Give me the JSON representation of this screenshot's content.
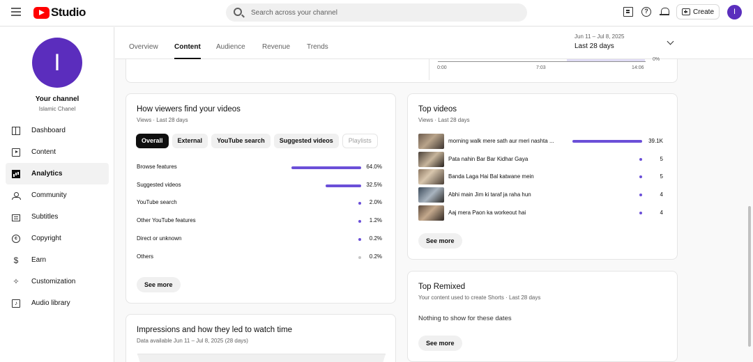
{
  "header": {
    "logo_text": "Studio",
    "search_placeholder": "Search across your channel",
    "create_label": "Create",
    "avatar_letter": "I"
  },
  "sidebar": {
    "avatar_letter": "I",
    "channel_title": "Your channel",
    "channel_name": "Islamic Chanel",
    "items": [
      {
        "label": "Dashboard",
        "icon": "dashboard-icon"
      },
      {
        "label": "Content",
        "icon": "content-icon"
      },
      {
        "label": "Analytics",
        "icon": "analytics-icon",
        "active": true
      },
      {
        "label": "Community",
        "icon": "community-icon"
      },
      {
        "label": "Subtitles",
        "icon": "subtitles-icon"
      },
      {
        "label": "Copyright",
        "icon": "copyright-icon"
      },
      {
        "label": "Earn",
        "icon": "earn-icon"
      },
      {
        "label": "Customization",
        "icon": "customization-icon"
      },
      {
        "label": "Audio library",
        "icon": "audio-library-icon"
      }
    ]
  },
  "tabs": {
    "items": [
      "Overview",
      "Content",
      "Audience",
      "Revenue",
      "Trends"
    ],
    "active": "Content",
    "date_range": "Jun 11 – Jul 8, 2025",
    "date_label": "Last 28 days"
  },
  "realtime_chart": {
    "ticks": [
      "0:00",
      "7:03",
      "14:06"
    ],
    "y_label": "0%"
  },
  "traffic": {
    "title": "How viewers find your videos",
    "subtitle": "Views · Last 28 days",
    "chips": [
      "Overall",
      "External",
      "YouTube search",
      "Suggested videos",
      "Playlists"
    ],
    "active_chip": "Overall",
    "disabled_chip": "Playlists",
    "rows": [
      {
        "label": "Browse features",
        "value": "64.0%",
        "pct": 64.0
      },
      {
        "label": "Suggested videos",
        "value": "32.5%",
        "pct": 32.5
      },
      {
        "label": "YouTube search",
        "value": "2.0%",
        "pct": 2.0
      },
      {
        "label": "Other YouTube features",
        "value": "1.2%",
        "pct": 1.2
      },
      {
        "label": "Direct or unknown",
        "value": "0.2%",
        "pct": 0.2
      },
      {
        "label": "Others",
        "value": "0.2%",
        "pct": 0.2
      }
    ],
    "see_more": "See more"
  },
  "top_videos": {
    "title": "Top videos",
    "subtitle": "Views · Last 28 days",
    "rows": [
      {
        "title": "morning walk mere sath aur meri nashta ...",
        "views": "39.1K",
        "value": 39100
      },
      {
        "title": "Pata nahin Bar Bar Kidhar Gaya",
        "views": "5",
        "value": 5
      },
      {
        "title": "Banda Laga Hai Bal katwane mein",
        "views": "5",
        "value": 5
      },
      {
        "title": "Abhi main Jim ki taraf ja raha hun",
        "views": "4",
        "value": 4
      },
      {
        "title": "Aaj mera Paon ka workeout hai",
        "views": "4",
        "value": 4
      }
    ],
    "see_more": "See more"
  },
  "top_remixed": {
    "title": "Top Remixed",
    "subtitle": "Your content used to create Shorts · Last 28 days",
    "empty_text": "Nothing to show for these dates",
    "see_more": "See more"
  },
  "impressions": {
    "title": "Impressions and how they led to watch time",
    "subtitle": "Data available Jun 11 – Jul 8, 2025 (28 days)"
  },
  "colors": {
    "accent": "#6b4fd8",
    "avatar": "#5b2dbd",
    "brand_red": "#ff0000"
  }
}
